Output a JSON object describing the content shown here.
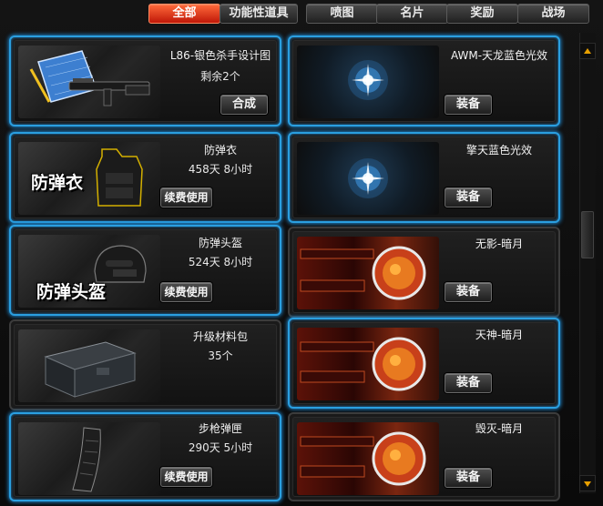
{
  "tabs": [
    {
      "label": "全部",
      "active": true
    },
    {
      "label": "功能性道具",
      "active": false
    },
    {
      "label": "喷图",
      "active": false
    },
    {
      "label": "名片",
      "active": false
    },
    {
      "label": "奖励",
      "active": false
    },
    {
      "label": "战场",
      "active": false
    }
  ],
  "items": [
    {
      "name": "L86-银色杀手设计图",
      "line2": "剩余2个",
      "button": "合成",
      "icon": "blueprint-gun-icon",
      "highlighted": true
    },
    {
      "name": "AWM-天龙蓝色光效",
      "line2": "",
      "button": "装备",
      "icon": "blue-glow-effect-icon",
      "highlighted": true
    },
    {
      "name": "防弹衣",
      "line2": "458天 8小时",
      "button": "续费使用",
      "icon": "body-armor-icon",
      "overlay": "防弹衣",
      "highlighted": true
    },
    {
      "name": "擎天蓝色光效",
      "line2": "",
      "button": "装备",
      "icon": "blue-glow-effect-icon",
      "highlighted": true
    },
    {
      "name": "防弹头盔",
      "line2": "524天 8小时",
      "button": "续费使用",
      "icon": "helmet-icon",
      "overlay": "防弹头盔",
      "highlighted": true
    },
    {
      "name": "无影-暗月",
      "line2": "",
      "button": "装备",
      "icon": "dark-moon-weapon-icon",
      "highlighted": false
    },
    {
      "name": "升级材料包",
      "line2": "35个",
      "button": "",
      "icon": "material-case-icon",
      "highlighted": false
    },
    {
      "name": "天神-暗月",
      "line2": "",
      "button": "装备",
      "icon": "dark-moon-weapon-icon",
      "highlighted": true
    },
    {
      "name": "步枪弹匣",
      "line2": "290天 5小时",
      "button": "续费使用",
      "icon": "rifle-magazine-icon",
      "highlighted": true
    },
    {
      "name": "毁灭-暗月",
      "line2": "",
      "button": "装备",
      "icon": "dark-moon-weapon-icon",
      "highlighted": false
    }
  ],
  "colors": {
    "accent_tab": "#e0401a",
    "highlight_border": "#2a9fe0",
    "scroll_arrow": "#e8a000"
  }
}
